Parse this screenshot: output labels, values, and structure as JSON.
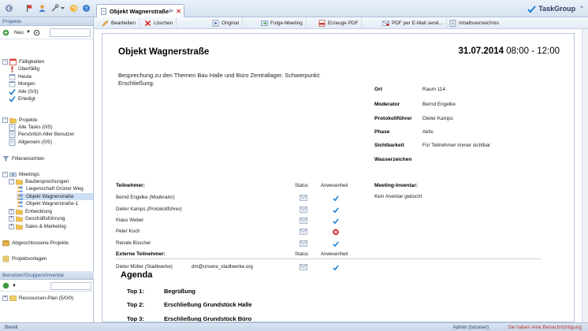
{
  "document_tab": {
    "title": "Objekt Wagnerstraße"
  },
  "brand": {
    "name": "TaskGroup"
  },
  "left_panel": {
    "header": "Projekte",
    "new_label": "Neu",
    "tree": [
      {
        "label": "Fälligkeiten",
        "level": 0,
        "icon": "calendar"
      },
      {
        "label": "Überfällig",
        "level": 1,
        "icon": "exclamation"
      },
      {
        "label": "Heute",
        "level": 1,
        "icon": "calendar-small"
      },
      {
        "label": "Morgen",
        "level": 1,
        "icon": "calendar-small"
      },
      {
        "label": "Alle (0/3)",
        "level": 1,
        "icon": "check-blue"
      },
      {
        "label": "Erledigt",
        "level": 1,
        "icon": "check-blue"
      },
      {
        "label": "Projekte",
        "level": 0,
        "icon": "folder"
      },
      {
        "label": "Alle Tasks (0/5)",
        "level": 1,
        "icon": "task"
      },
      {
        "label": "Persönlich Aller Benutzer",
        "level": 1,
        "icon": "task"
      },
      {
        "label": "Allgemein (0/5)",
        "level": 1,
        "icon": "task"
      },
      {
        "label": "Filteransichten",
        "level": 0,
        "icon": "filter"
      },
      {
        "label": "Meetings",
        "level": 0,
        "icon": "meeting"
      },
      {
        "label": "Baubesprechungen",
        "level": 1,
        "icon": "folder"
      },
      {
        "label": "Liegenschaft Grüner Weg",
        "level": 2,
        "icon": "people"
      },
      {
        "label": "Objekt Wagnerstraße",
        "level": 2,
        "icon": "people"
      },
      {
        "label": "Objekt Wagnerstraße-1",
        "level": 2,
        "icon": "people"
      },
      {
        "label": "Entwicklung",
        "level": 1,
        "icon": "folder"
      },
      {
        "label": "Geschäftsführung",
        "level": 1,
        "icon": "folder"
      },
      {
        "label": "Sales & Marketing",
        "level": 1,
        "icon": "folder"
      },
      {
        "label": "Abgeschlossene Projekte",
        "level": 0,
        "icon": "archive"
      },
      {
        "label": "Projektvorlagen",
        "level": 0,
        "icon": "template"
      }
    ],
    "bottom_header": "Benutzer/Gruppen/Inventar",
    "bottom_tree": [
      {
        "label": "Ressourcen-Plan (5/0/0)"
      }
    ]
  },
  "actions": [
    {
      "label": "Bearbeiten",
      "icon": "edit"
    },
    {
      "label": "Löschen",
      "icon": "delete"
    },
    {
      "label": "Original",
      "icon": "original"
    },
    {
      "label": "Folge-Meeting",
      "icon": "followup"
    },
    {
      "label": "Erzeuge PDF",
      "icon": "pdf"
    },
    {
      "label": "PDF per E-Mail send...",
      "icon": "pdf-mail"
    },
    {
      "label": "Inhaltsverzeichnis",
      "icon": "toc"
    }
  ],
  "meeting": {
    "title": "Objekt Wagnerstraße",
    "date": "31.07.2014",
    "time": "08:00 - 12:00",
    "description": "Besprechung zu den Themen Bau Halle und Büro Zentrallager. Schwerpunkt: Erschließung.",
    "info": [
      {
        "label": "Ort",
        "value": "Raum 114"
      },
      {
        "label": "Moderator",
        "value": "Bernd Engelke"
      },
      {
        "label": "Protokollführer",
        "value": "Dieter Kamps"
      },
      {
        "label": "Phase",
        "value": "Aktiv"
      },
      {
        "label": "Sichtbarkeit",
        "value": "Für Teilnehmer immer sichtbar"
      },
      {
        "label": "Wasserzeichen",
        "value": ""
      }
    ],
    "participants_header": "Teilnehmer:",
    "status_header": "Status",
    "attendance_header": "Anwesenheit",
    "participants": [
      {
        "name": "Bernd Engelke",
        "role": "(Moderator)",
        "present": true
      },
      {
        "name": "Dieter Kamps",
        "role": "(Protokollführer)",
        "present": true
      },
      {
        "name": "Klaus Weber",
        "role": "",
        "present": true
      },
      {
        "name": "Peter Koch",
        "role": "",
        "present": false
      },
      {
        "name": "Renate Büscher",
        "role": "",
        "present": true
      }
    ],
    "external_header": "Externe Teilnehmer:",
    "external": [
      {
        "name": "Dieter Müller (Stadtwerke)",
        "email": "dm@unsere_stadtwerke.org",
        "present": true
      }
    ],
    "inventory_header": "Meeting-Inventar:",
    "inventory_empty": "Kein Inventar gebucht",
    "agenda_title": "Agenda",
    "agenda": [
      {
        "label": "Top 1:",
        "text": "Begrüßung"
      },
      {
        "label": "Top 2:",
        "text": "Erschließung Grundstück Halle"
      },
      {
        "label": "Top 3:",
        "text": "Erschließung Grundstück Büro"
      }
    ]
  },
  "status_bar": {
    "left": "Bereit",
    "user": "Admin (txtraser)",
    "note": "Sie haben eine Benachrichtigung"
  },
  "colors": {
    "accent": "#3b5a86",
    "check": "#1f7fd1",
    "cross": "#d0342c"
  }
}
